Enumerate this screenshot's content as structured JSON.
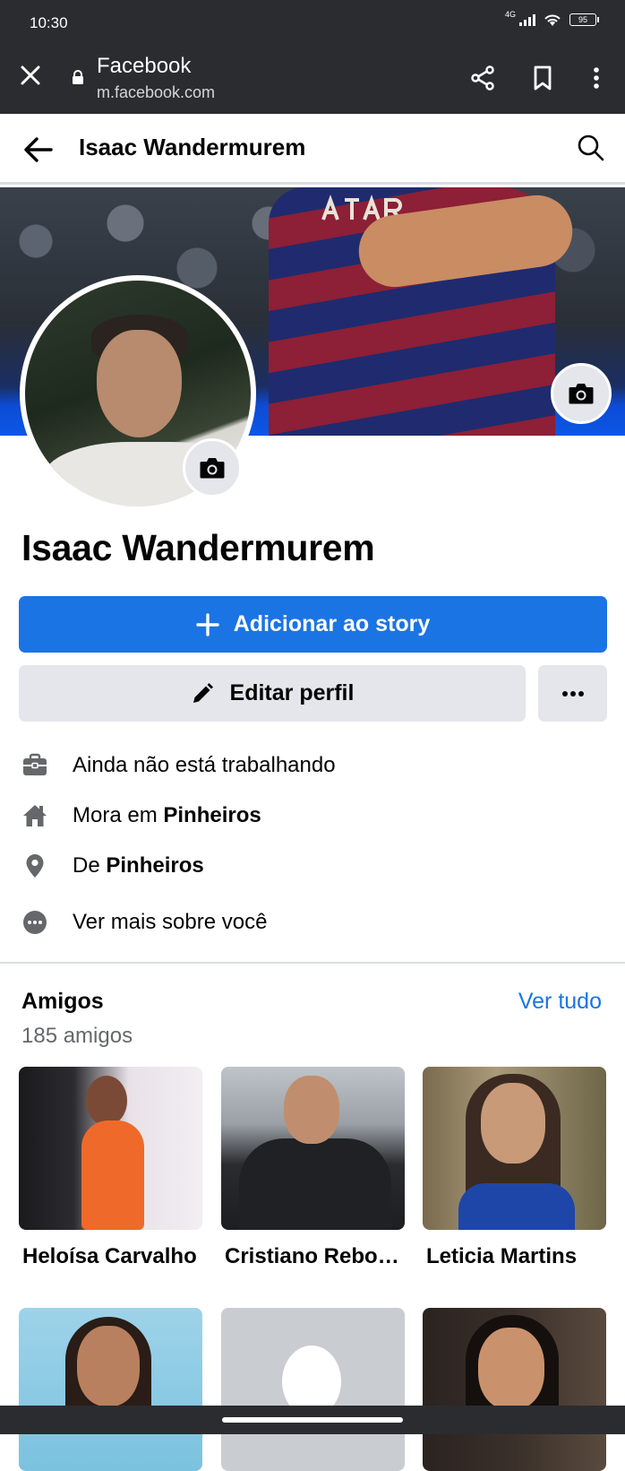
{
  "status_bar": {
    "time": "10:30",
    "network": "4G",
    "battery": "95"
  },
  "browser": {
    "title": "Facebook",
    "url": "m.facebook.com"
  },
  "header": {
    "title": "Isaac Wandermurem"
  },
  "profile": {
    "name": "Isaac Wandermurem",
    "add_story_label": "Adicionar ao story",
    "edit_profile_label": "Editar perfil",
    "more_label": "•••"
  },
  "info": {
    "work": "Ainda não está trabalhando",
    "lives_prefix": "Mora em ",
    "lives_place": "Pinheiros",
    "from_prefix": "De ",
    "from_place": "Pinheiros",
    "see_more": "Ver mais sobre você"
  },
  "friends": {
    "title": "Amigos",
    "see_all": "Ver tudo",
    "count": "185 amigos",
    "items": [
      {
        "name": "Heloísa Carvalho"
      },
      {
        "name": "Cristiano Rebouças"
      },
      {
        "name": "Leticia Martins"
      }
    ]
  },
  "colors": {
    "brand_blue": "#1b74e4",
    "button_gray": "#e4e6eb",
    "system_bar": "#2b2c30"
  },
  "icons": [
    "close-icon",
    "lock-icon",
    "share-icon",
    "bookmark-icon",
    "more-vert-icon",
    "back-arrow-icon",
    "search-icon",
    "camera-icon",
    "plus-icon",
    "pencil-icon",
    "briefcase-icon",
    "home-icon",
    "location-pin-icon",
    "more-dots-icon"
  ]
}
